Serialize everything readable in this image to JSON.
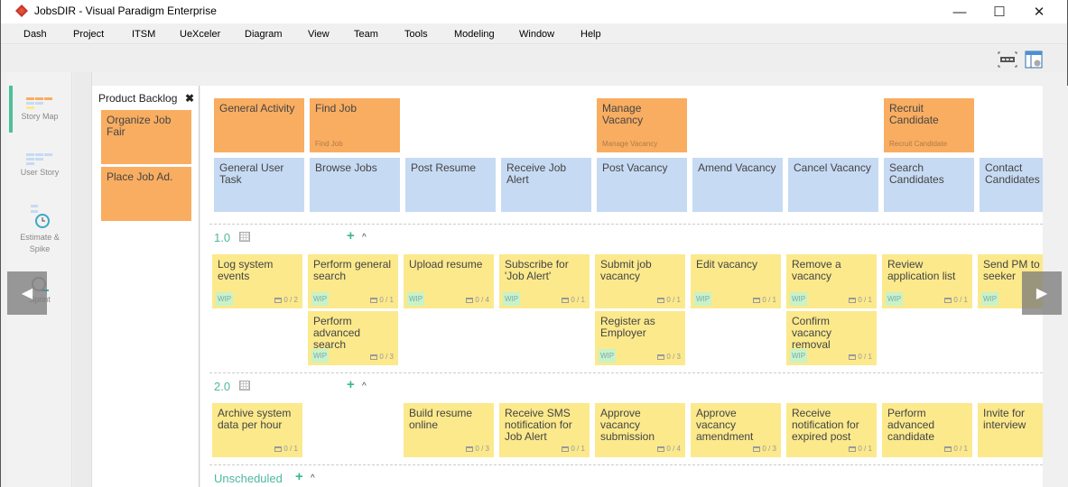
{
  "window": {
    "title": "JobsDIR - Visual Paradigm Enterprise",
    "controls": {
      "minimize": "—",
      "maximize": "☐",
      "close": "✕"
    }
  },
  "menubar": [
    "Dash",
    "Project",
    "ITSM",
    "UeXceler",
    "Diagram",
    "View",
    "Team",
    "Tools",
    "Modeling",
    "Window",
    "Help"
  ],
  "leftnav": {
    "items": [
      {
        "label": "Story Map",
        "icon": "story-map-icon",
        "active": true
      },
      {
        "label": "User Story",
        "icon": "user-story-icon",
        "active": false
      },
      {
        "label": "Estimate & Spike",
        "icon": "estimate-spike-icon",
        "active": false
      },
      {
        "label": "Sprint",
        "icon": "sprint-icon",
        "active": false
      }
    ]
  },
  "backlog": {
    "title": "Product Backlog",
    "close_icon": "✖",
    "items": [
      "Organize Job Fair",
      "Place Job Ad."
    ]
  },
  "activities": [
    {
      "title": "General Activity",
      "sub": ""
    },
    {
      "title": "Find Job",
      "sub": "Find Job"
    },
    {
      "title": "Manage Vacancy",
      "sub": "Manage Vacancy"
    },
    {
      "title": "Recruit Candidate",
      "sub": "Recruit Candidate"
    }
  ],
  "tasks": [
    "General User Task",
    "Browse Jobs",
    "Post Resume",
    "Receive Job Alert",
    "Post Vacancy",
    "Amend Vacancy",
    "Cancel Vacancy",
    "Search Candidates",
    "Contact Candidates"
  ],
  "releases": [
    {
      "label": "1.0",
      "stories": [
        {
          "title": "Log system events",
          "wip": "WIP",
          "count": "0 / 2"
        },
        {
          "title": "Perform general search",
          "wip": "WIP",
          "count": "0 / 1"
        },
        {
          "title": "Upload resume",
          "wip": "WIP",
          "count": "0 / 4"
        },
        {
          "title": "Subscribe for 'Job Alert'",
          "wip": "WIP",
          "count": "0 / 1"
        },
        {
          "title": "Submit job vacancy",
          "wip": "",
          "count": "0 / 1"
        },
        {
          "title": "Edit vacancy",
          "wip": "WIP",
          "count": "0 / 1"
        },
        {
          "title": "Remove a vacancy",
          "wip": "WIP",
          "count": "0 / 1"
        },
        {
          "title": "Review application list",
          "wip": "WIP",
          "count": "0 / 1"
        },
        {
          "title": "Send PM to seeker",
          "wip": "WIP",
          "count": ""
        },
        {
          "title": "Perform advanced search",
          "wip": "WIP",
          "count": "0 / 3"
        },
        {
          "title": "Register as Employer",
          "wip": "WIP",
          "count": "0 / 3"
        },
        {
          "title": "Confirm vacancy removal",
          "wip": "WIP",
          "count": "0 / 1"
        }
      ]
    },
    {
      "label": "2.0",
      "stories": [
        {
          "title": "Archive system data per hour",
          "wip": "",
          "count": "0 / 1"
        },
        {
          "title": "Build resume online",
          "wip": "",
          "count": "0 / 3"
        },
        {
          "title": "Receive SMS notification for Job Alert",
          "wip": "",
          "count": "0 / 1"
        },
        {
          "title": "Approve vacancy submission",
          "wip": "",
          "count": "0 / 4"
        },
        {
          "title": "Approve vacancy amendment",
          "wip": "",
          "count": "0 / 3"
        },
        {
          "title": "Receive notification for expired post",
          "wip": "",
          "count": "0 / 1"
        },
        {
          "title": "Perform advanced candidate",
          "wip": "",
          "count": "0 / 1"
        },
        {
          "title": "Invite for interview",
          "wip": "",
          "count": ""
        }
      ]
    }
  ],
  "unscheduled": {
    "label": "Unscheduled"
  },
  "nav": {
    "prev": "◀",
    "next": "▶"
  },
  "colors": {
    "activity": "#f9ad61",
    "task": "#c7daf3",
    "story": "#fbe98c",
    "accent": "#4db8a0"
  }
}
